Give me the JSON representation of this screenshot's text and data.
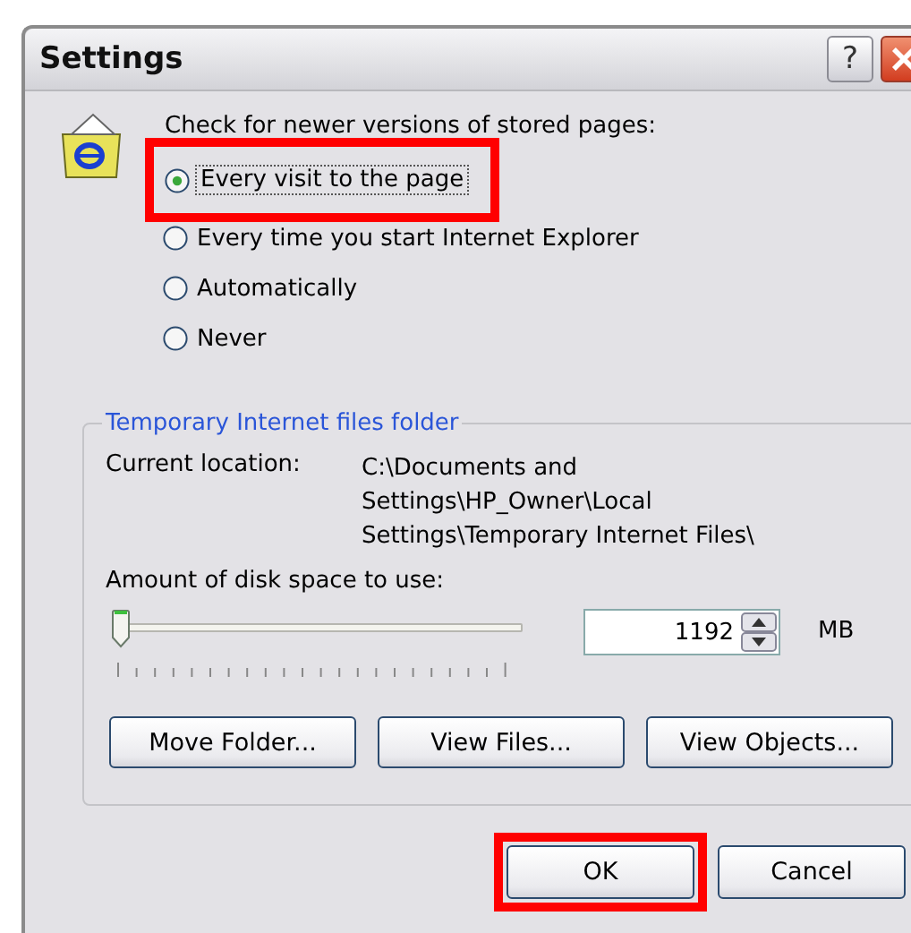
{
  "window": {
    "title": "Settings",
    "help_button": "?"
  },
  "check_prompt": "Check for newer versions of stored pages:",
  "options": [
    {
      "label": "Every visit to the page",
      "selected": true,
      "highlighted": true
    },
    {
      "label": "Every time you start Internet Explorer",
      "selected": false,
      "highlighted": false
    },
    {
      "label": "Automatically",
      "selected": false,
      "highlighted": false
    },
    {
      "label": "Never",
      "selected": false,
      "highlighted": false
    }
  ],
  "group": {
    "title": "Temporary Internet files folder",
    "location_label": "Current location:",
    "location_lines": [
      "C:\\Documents and",
      "Settings\\HP_Owner\\Local",
      "Settings\\Temporary Internet Files\\"
    ],
    "space_label": "Amount of disk space to use:",
    "slider": {
      "level": 0.0
    },
    "space_value": "1192",
    "unit": "MB",
    "buttons": [
      {
        "label": "Move Folder..."
      },
      {
        "label": "View Files..."
      },
      {
        "label": "View Objects..."
      }
    ]
  },
  "footer_buttons": [
    {
      "label": "OK",
      "highlighted": true
    },
    {
      "label": "Cancel",
      "highlighted": false
    }
  ]
}
